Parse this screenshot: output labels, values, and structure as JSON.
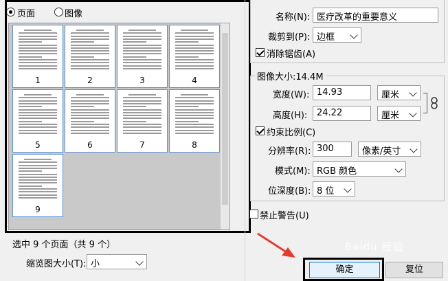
{
  "left": {
    "radio_page": "页面",
    "radio_image": "图像",
    "pages": [
      "1",
      "2",
      "3",
      "4",
      "5",
      "6",
      "7",
      "8",
      "9"
    ],
    "selection_status": "选中 9 个页面（共 9 个）",
    "thumb_size_label": "缩览图大小(T):",
    "thumb_size_value": "小"
  },
  "right": {
    "name_label": "名称(N):",
    "name_value": "医疗改革的重要意义",
    "crop_label": "裁剪到(P):",
    "crop_value": "边框",
    "antialias_label": "消除锯齿(A)",
    "image_size_label": "图像大小:14.4M",
    "width_label": "宽度(W):",
    "width_value": "14.93",
    "width_unit": "厘米",
    "height_label": "高度(H):",
    "height_value": "24.22",
    "height_unit": "厘米",
    "constrain_label": "约束比例(C)",
    "resolution_label": "分辨率(R):",
    "resolution_value": "300",
    "resolution_unit": "像素/英寸",
    "mode_label": "模式(M):",
    "mode_value": "RGB 颜色",
    "depth_label": "位深度(B):",
    "depth_value": "8 位",
    "suppress_label": "禁止警告(U)"
  },
  "buttons": {
    "ok": "确定",
    "reset": "复位"
  },
  "watermark": "Baidu 经验",
  "colors": {
    "accent_border": "#5a8fcf",
    "arrow": "#e33b2e"
  }
}
